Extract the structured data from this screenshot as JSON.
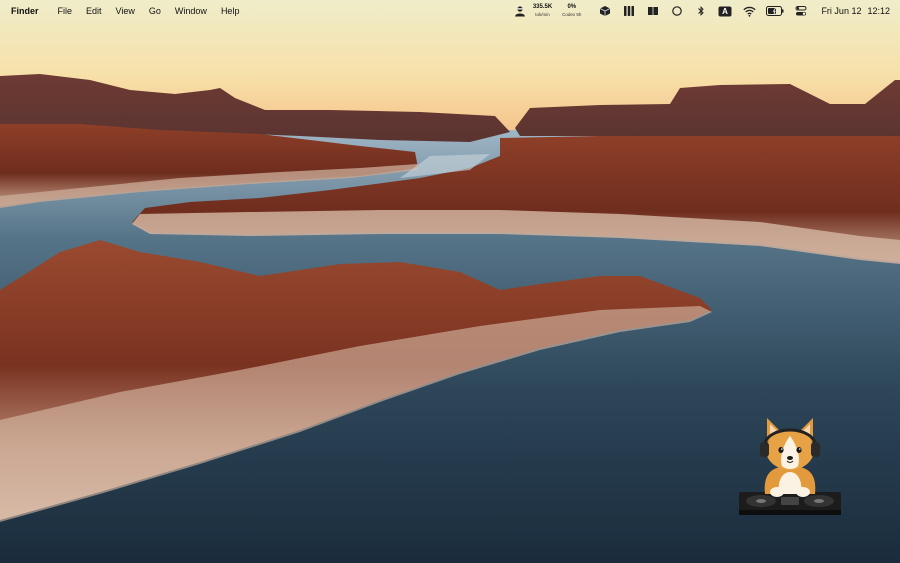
{
  "menubar": {
    "app_name": "Finder",
    "menus": [
      "File",
      "Edit",
      "View",
      "Go",
      "Window",
      "Help"
    ]
  },
  "status": {
    "tokens_value": "335.5K",
    "tokens_unit": "tok/min",
    "codex_value": "0%",
    "codex_label": "Codex 5h",
    "input_source": "A"
  },
  "clock": {
    "date": "Fri Jun 12",
    "time": "12:12"
  },
  "icons": [
    "agent-icon",
    "box-icon",
    "grid-icon",
    "book-icon",
    "circle-icon",
    "bluetooth-icon",
    "keyboard-input-icon",
    "wifi-icon",
    "battery-icon",
    "control-center-icon",
    "corgi-dj-widget"
  ],
  "colors": {
    "sky_top": "#f4ecc4",
    "sky_horizon": "#f6c98e",
    "water": "#2f4557",
    "rock": "#8a3a26"
  }
}
